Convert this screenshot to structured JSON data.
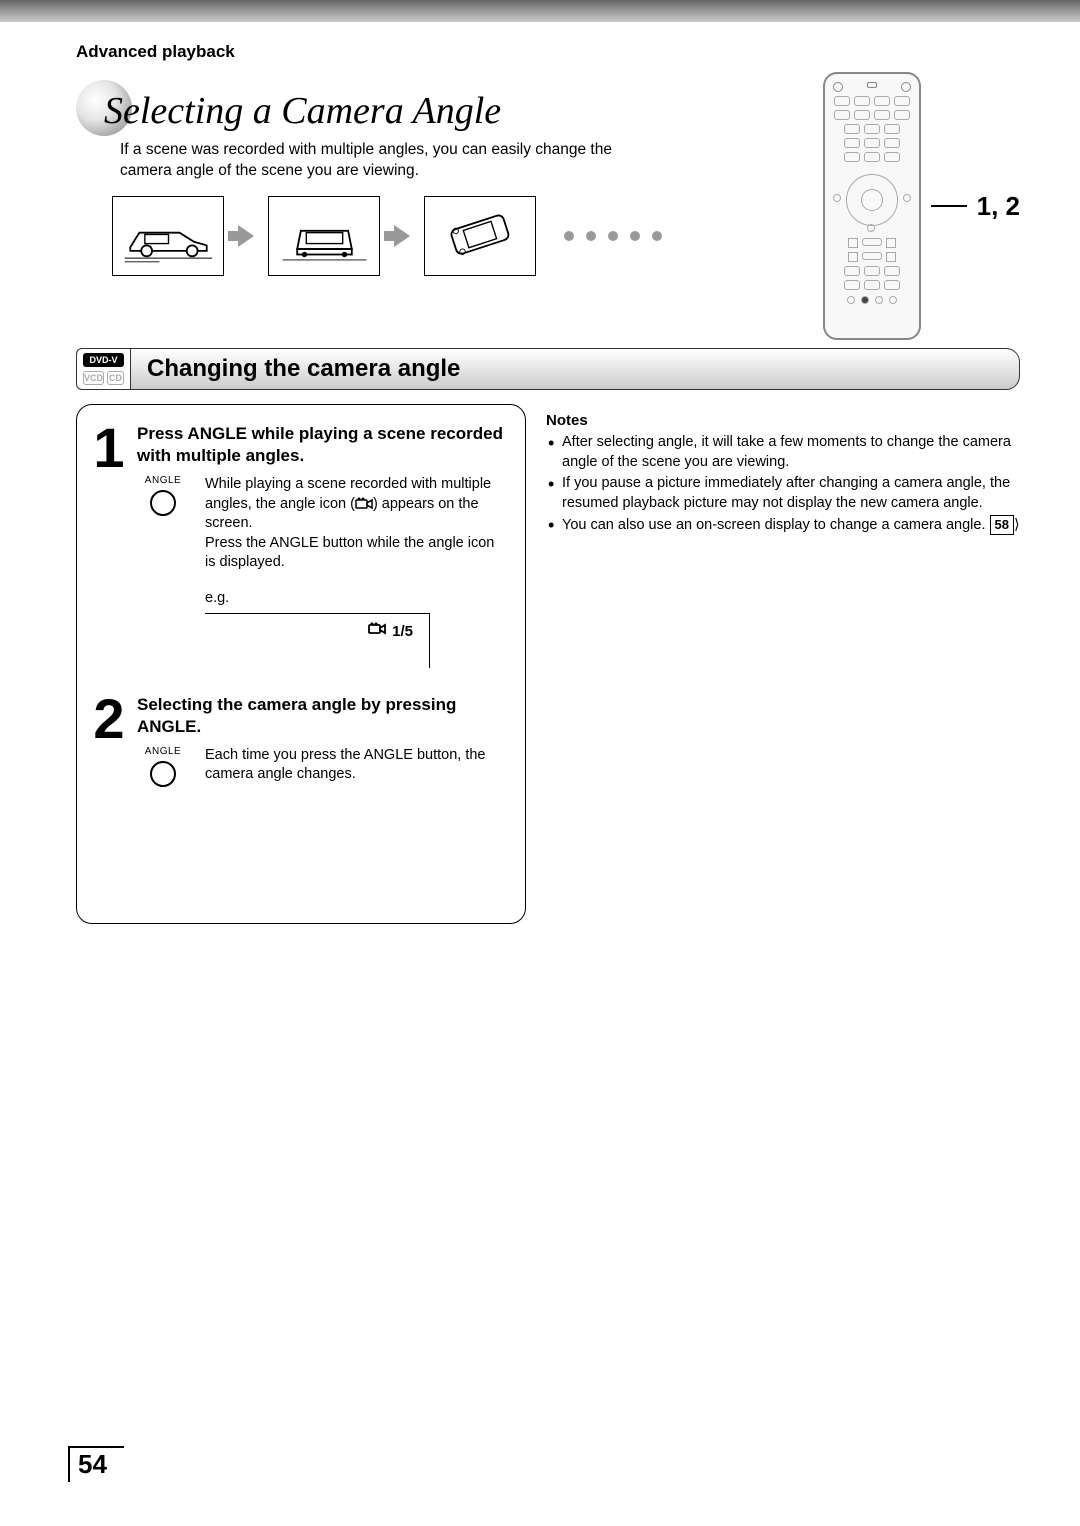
{
  "section_label": "Advanced playback",
  "page_title": "Selecting a Camera Angle",
  "intro": "If a scene was recorded with multiple angles, you can easily change the camera angle of the scene you are viewing.",
  "remote_callout": "1, 2",
  "disc_tags": {
    "primary": "DVD-V",
    "secondary": [
      "VCD",
      "CD"
    ]
  },
  "section_heading": "Changing the camera angle",
  "steps": [
    {
      "num": "1",
      "title": "Press ANGLE while playing a scene recorded with multiple angles.",
      "button_label": "ANGLE",
      "text_a": "While playing a scene recorded with multiple angles, the angle icon (",
      "text_b": ") appears on the screen.",
      "text_c": "Press the ANGLE button while the angle icon is displayed.",
      "eg_label": "e.g.",
      "eg_value": "1/5"
    },
    {
      "num": "2",
      "title": "Selecting the camera angle by pressing ANGLE.",
      "button_label": "ANGLE",
      "text": "Each time you press the ANGLE button, the camera angle changes."
    }
  ],
  "notes_heading": "Notes",
  "notes": [
    "After selecting angle, it will take a few moments to change the camera angle of the scene you are viewing.",
    "If you pause a picture immediately after changing a camera angle, the resumed playback picture may not display the new camera angle.",
    "You can also use an on-screen display to change a camera angle."
  ],
  "note_ref": "58",
  "page_number": "54"
}
